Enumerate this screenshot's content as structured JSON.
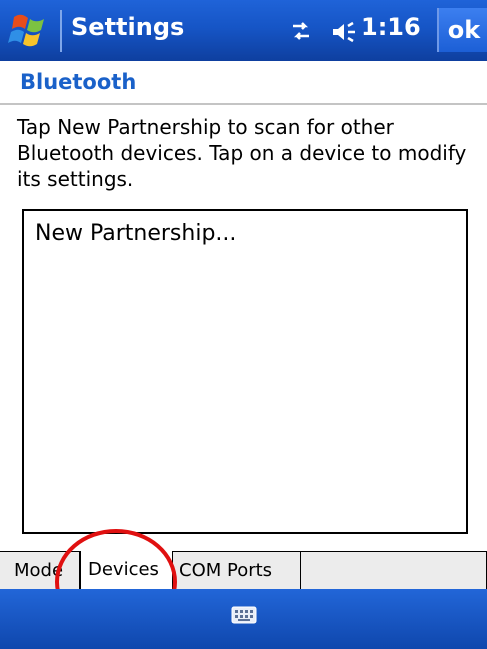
{
  "titlebar": {
    "title": "Settings",
    "clock": "1:16",
    "ok_label": "ok",
    "icons": [
      "windows-start-icon",
      "connectivity-icon",
      "speaker-icon"
    ]
  },
  "subheader": {
    "title": "Bluetooth"
  },
  "description": "Tap New Partnership to scan for other Bluetooth devices. Tap on a device to modify its settings.",
  "device_list": {
    "items": [
      "New Partnership..."
    ]
  },
  "tabs": [
    {
      "label": "Mode",
      "selected": false
    },
    {
      "label": "Devices",
      "selected": true
    },
    {
      "label": "COM Ports",
      "selected": false
    }
  ],
  "bottombar": {
    "icons": [
      "keyboard-icon"
    ]
  },
  "colors": {
    "titlebar_blue": "#1655c6",
    "header_text_blue": "#1a61c9",
    "highlight_red": "#e01010"
  }
}
